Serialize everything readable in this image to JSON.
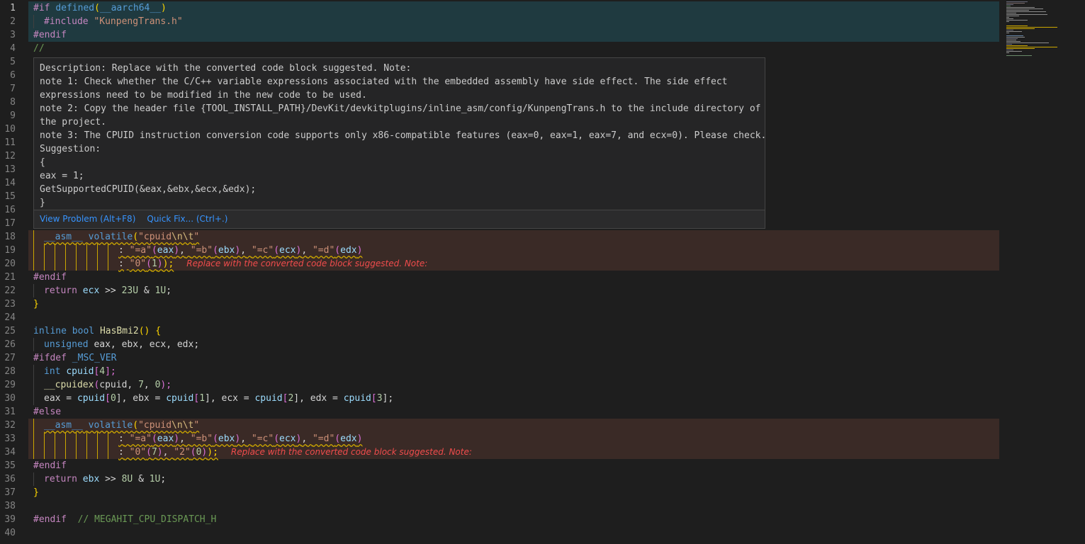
{
  "gutter": {
    "line_numbers": [
      "1",
      "2",
      "3",
      "4",
      "5",
      "6",
      "7",
      "8",
      "9",
      "10",
      "11",
      "12",
      "13",
      "14",
      "15",
      "16",
      "17",
      "18",
      "19",
      "20",
      "21",
      "22",
      "23",
      "24",
      "25",
      "26",
      "27",
      "28",
      "29",
      "30",
      "31",
      "32",
      "33",
      "34",
      "35",
      "36",
      "37",
      "38",
      "39",
      "40"
    ]
  },
  "code": {
    "l1": [
      "#if",
      "defined",
      "(",
      "__aarch64__",
      ")"
    ],
    "l2": [
      "#include",
      "\"KunpengTrans.h\""
    ],
    "l3": "#endif",
    "l4": "//",
    "l18": [
      "__asm__",
      "volatile",
      "(",
      "\"cpuid",
      "\\n\\t",
      "\""
    ],
    "l19": [
      ":",
      "\"=a\"",
      "(",
      "eax",
      ")",
      ",",
      "\"=b\"",
      "(",
      "ebx",
      ")",
      ",",
      "\"=c\"",
      "(",
      "ecx",
      ")",
      ",",
      "\"=d\"",
      "(",
      "edx",
      ")"
    ],
    "l20": [
      ":",
      "\"0\"",
      "(",
      "1",
      ")",
      ");"
    ],
    "l21": "#endif",
    "l22": [
      "return",
      "ecx",
      ">>",
      "23U",
      "&",
      "1U",
      ";"
    ],
    "l23": "}",
    "l25": [
      "inline",
      "bool",
      "HasBmi2",
      "()",
      "{"
    ],
    "l26": [
      "unsigned",
      "eax, ebx, ecx, edx;"
    ],
    "l27": [
      "#ifdef",
      "_MSC_VER"
    ],
    "l28": [
      "int",
      "cpuid",
      "[",
      "4",
      "];"
    ],
    "l29": [
      "__cpuidex",
      "(",
      "cpuid, ",
      "7",
      ", ",
      "0",
      ");"
    ],
    "l30": [
      "eax",
      " = ",
      "cpuid",
      "[",
      "0",
      "], ",
      "ebx",
      " = ",
      "cpuid",
      "[",
      "1",
      "], ",
      "ecx",
      " = ",
      "cpuid",
      "[",
      "2",
      "], ",
      "edx",
      " = ",
      "cpuid",
      "[",
      "3",
      "];"
    ],
    "l31": "#else",
    "l32": [
      "__asm__",
      "volatile",
      "(",
      "\"cpuid",
      "\\n\\t",
      "\""
    ],
    "l33": [
      ":",
      "\"=a\"",
      "(",
      "eax",
      ")",
      ",",
      "\"=b\"",
      "(",
      "ebx",
      ")",
      ",",
      "\"=c\"",
      "(",
      "ecx",
      ")",
      ",",
      "\"=d\"",
      "(",
      "edx",
      ")"
    ],
    "l34": [
      ":",
      "\"0\"",
      "(",
      "7",
      ")",
      ",",
      "\"2\"",
      "(",
      "0",
      ")",
      ");"
    ],
    "l35": "#endif",
    "l36": [
      "return",
      "ebx",
      ">>",
      "8U",
      "&",
      "1U",
      ";"
    ],
    "l37": "}",
    "l39": [
      "#endif",
      "// MEGAHIT_CPU_DISPATCH_H"
    ]
  },
  "inline_diagnostics": {
    "l20": "Replace with the converted code block suggested. Note:",
    "l34": "Replace with the converted code block suggested. Note:"
  },
  "hover": {
    "lines": [
      "Description: Replace with the converted code block suggested. Note:",
      "note 1: Check whether the C/C++ variable expressions associated with the embedded assembly have side effect. The side effect",
      "expressions need to be modified in the new code to be used.",
      "note 2: Copy the header file {TOOL_INSTALL_PATH}/DevKit/devkitplugins/inline_asm/config/KunpengTrans.h to the include directory of",
      "the project.",
      "note 3: The CPUID instruction conversion code supports only x86-compatible features (eax=0, eax=1, eax=7, and ecx=0). Please check.",
      "Suggestion:",
      "{",
      "eax = 1;",
      "GetSupportedCPUID(&eax,&ebx,&ecx,&edx);",
      "}"
    ],
    "view_problem": "View Problem (Alt+F8)",
    "quick_fix": "Quick Fix... (Ctrl+.)"
  },
  "colors": {
    "background": "#1e1e1e",
    "warning_squiggle": "#cca700",
    "error_text": "#f14c4c",
    "link": "#3794ff"
  }
}
